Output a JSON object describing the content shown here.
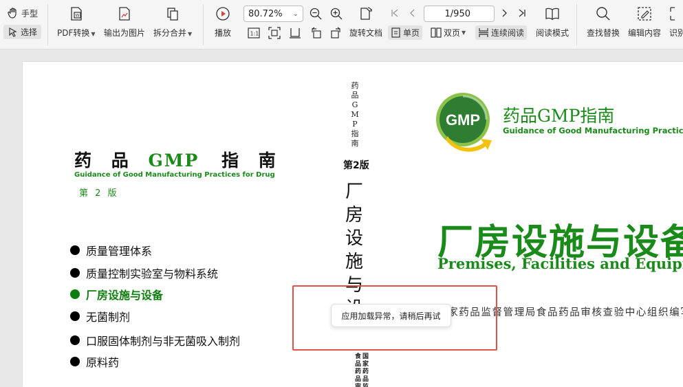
{
  "toolbar": {
    "hand_label": "手型",
    "select_label": "选择",
    "pdf_convert_label": "PDF转换",
    "export_image_label": "输出为图片",
    "split_merge_label": "拆分合并",
    "play_label": "播放",
    "zoom_value": "80.72%",
    "page_value": "1/950",
    "rotate_label": "旋转文档",
    "single_page_label": "单页",
    "double_page_label": "双页",
    "continuous_label": "连续阅读",
    "reading_mode_label": "阅读模式",
    "find_replace_label": "查找替换",
    "edit_content_label": "编辑内容",
    "ocr_label": "识别",
    "actual_size_glyph": "1:1"
  },
  "document": {
    "left": {
      "title_prefix": "药 品",
      "title_gmp": "GMP",
      "title_suffix": "指 南",
      "subtitle": "Guidance of Good Manufacturing Practices for Drug",
      "edition": "第 2 版",
      "toc": [
        {
          "label": "质量管理体系",
          "highlight": false
        },
        {
          "label": "质量控制实验室与物料系统",
          "highlight": false
        },
        {
          "label": "厂房设施与设备",
          "highlight": true
        },
        {
          "label": "无菌制剂",
          "highlight": false
        },
        {
          "label": "口服固体制剂与非无菌吸入制剂",
          "highlight": false
        },
        {
          "label": "原料药",
          "highlight": false
        }
      ]
    },
    "spine": {
      "small_title": "药品GMP指南",
      "edition": "第2版",
      "big_title": "厂房设施与设",
      "tiny_col1": "国家药品监",
      "tiny_col2": "食品药品审核"
    },
    "right": {
      "logo_text": "GMP",
      "logo_title": "药品GMP指南",
      "logo_subtitle": "Guidance of Good Manufacturing Practices for Drug",
      "main_title_cn": "厂房设施与设备",
      "main_title_en": "Premises, Facilities and Equipment",
      "editor": "国家药品监督管理局食品药品审核查验中心组织编写"
    }
  },
  "toast": {
    "message": "应用加载异常，请稍后再试"
  },
  "colors": {
    "brand_green": "#1a8a1a",
    "error_frame": "#e35248"
  }
}
